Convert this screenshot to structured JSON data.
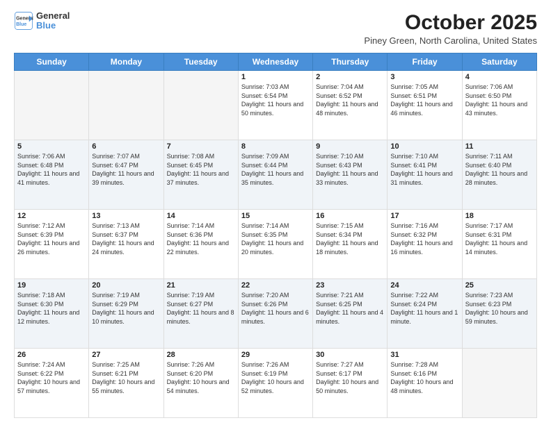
{
  "logo": {
    "line1": "General",
    "line2": "Blue"
  },
  "title": {
    "month_year": "October 2025",
    "location": "Piney Green, North Carolina, United States"
  },
  "days_of_week": [
    "Sunday",
    "Monday",
    "Tuesday",
    "Wednesday",
    "Thursday",
    "Friday",
    "Saturday"
  ],
  "weeks": [
    [
      {
        "day": "",
        "sunrise": "",
        "sunset": "",
        "daylight": ""
      },
      {
        "day": "",
        "sunrise": "",
        "sunset": "",
        "daylight": ""
      },
      {
        "day": "",
        "sunrise": "",
        "sunset": "",
        "daylight": ""
      },
      {
        "day": "1",
        "sunrise": "Sunrise: 7:03 AM",
        "sunset": "Sunset: 6:54 PM",
        "daylight": "Daylight: 11 hours and 50 minutes."
      },
      {
        "day": "2",
        "sunrise": "Sunrise: 7:04 AM",
        "sunset": "Sunset: 6:52 PM",
        "daylight": "Daylight: 11 hours and 48 minutes."
      },
      {
        "day": "3",
        "sunrise": "Sunrise: 7:05 AM",
        "sunset": "Sunset: 6:51 PM",
        "daylight": "Daylight: 11 hours and 46 minutes."
      },
      {
        "day": "4",
        "sunrise": "Sunrise: 7:06 AM",
        "sunset": "Sunset: 6:50 PM",
        "daylight": "Daylight: 11 hours and 43 minutes."
      }
    ],
    [
      {
        "day": "5",
        "sunrise": "Sunrise: 7:06 AM",
        "sunset": "Sunset: 6:48 PM",
        "daylight": "Daylight: 11 hours and 41 minutes."
      },
      {
        "day": "6",
        "sunrise": "Sunrise: 7:07 AM",
        "sunset": "Sunset: 6:47 PM",
        "daylight": "Daylight: 11 hours and 39 minutes."
      },
      {
        "day": "7",
        "sunrise": "Sunrise: 7:08 AM",
        "sunset": "Sunset: 6:45 PM",
        "daylight": "Daylight: 11 hours and 37 minutes."
      },
      {
        "day": "8",
        "sunrise": "Sunrise: 7:09 AM",
        "sunset": "Sunset: 6:44 PM",
        "daylight": "Daylight: 11 hours and 35 minutes."
      },
      {
        "day": "9",
        "sunrise": "Sunrise: 7:10 AM",
        "sunset": "Sunset: 6:43 PM",
        "daylight": "Daylight: 11 hours and 33 minutes."
      },
      {
        "day": "10",
        "sunrise": "Sunrise: 7:10 AM",
        "sunset": "Sunset: 6:41 PM",
        "daylight": "Daylight: 11 hours and 31 minutes."
      },
      {
        "day": "11",
        "sunrise": "Sunrise: 7:11 AM",
        "sunset": "Sunset: 6:40 PM",
        "daylight": "Daylight: 11 hours and 28 minutes."
      }
    ],
    [
      {
        "day": "12",
        "sunrise": "Sunrise: 7:12 AM",
        "sunset": "Sunset: 6:39 PM",
        "daylight": "Daylight: 11 hours and 26 minutes."
      },
      {
        "day": "13",
        "sunrise": "Sunrise: 7:13 AM",
        "sunset": "Sunset: 6:37 PM",
        "daylight": "Daylight: 11 hours and 24 minutes."
      },
      {
        "day": "14",
        "sunrise": "Sunrise: 7:14 AM",
        "sunset": "Sunset: 6:36 PM",
        "daylight": "Daylight: 11 hours and 22 minutes."
      },
      {
        "day": "15",
        "sunrise": "Sunrise: 7:14 AM",
        "sunset": "Sunset: 6:35 PM",
        "daylight": "Daylight: 11 hours and 20 minutes."
      },
      {
        "day": "16",
        "sunrise": "Sunrise: 7:15 AM",
        "sunset": "Sunset: 6:34 PM",
        "daylight": "Daylight: 11 hours and 18 minutes."
      },
      {
        "day": "17",
        "sunrise": "Sunrise: 7:16 AM",
        "sunset": "Sunset: 6:32 PM",
        "daylight": "Daylight: 11 hours and 16 minutes."
      },
      {
        "day": "18",
        "sunrise": "Sunrise: 7:17 AM",
        "sunset": "Sunset: 6:31 PM",
        "daylight": "Daylight: 11 hours and 14 minutes."
      }
    ],
    [
      {
        "day": "19",
        "sunrise": "Sunrise: 7:18 AM",
        "sunset": "Sunset: 6:30 PM",
        "daylight": "Daylight: 11 hours and 12 minutes."
      },
      {
        "day": "20",
        "sunrise": "Sunrise: 7:19 AM",
        "sunset": "Sunset: 6:29 PM",
        "daylight": "Daylight: 11 hours and 10 minutes."
      },
      {
        "day": "21",
        "sunrise": "Sunrise: 7:19 AM",
        "sunset": "Sunset: 6:27 PM",
        "daylight": "Daylight: 11 hours and 8 minutes."
      },
      {
        "day": "22",
        "sunrise": "Sunrise: 7:20 AM",
        "sunset": "Sunset: 6:26 PM",
        "daylight": "Daylight: 11 hours and 6 minutes."
      },
      {
        "day": "23",
        "sunrise": "Sunrise: 7:21 AM",
        "sunset": "Sunset: 6:25 PM",
        "daylight": "Daylight: 11 hours and 4 minutes."
      },
      {
        "day": "24",
        "sunrise": "Sunrise: 7:22 AM",
        "sunset": "Sunset: 6:24 PM",
        "daylight": "Daylight: 11 hours and 1 minute."
      },
      {
        "day": "25",
        "sunrise": "Sunrise: 7:23 AM",
        "sunset": "Sunset: 6:23 PM",
        "daylight": "Daylight: 10 hours and 59 minutes."
      }
    ],
    [
      {
        "day": "26",
        "sunrise": "Sunrise: 7:24 AM",
        "sunset": "Sunset: 6:22 PM",
        "daylight": "Daylight: 10 hours and 57 minutes."
      },
      {
        "day": "27",
        "sunrise": "Sunrise: 7:25 AM",
        "sunset": "Sunset: 6:21 PM",
        "daylight": "Daylight: 10 hours and 55 minutes."
      },
      {
        "day": "28",
        "sunrise": "Sunrise: 7:26 AM",
        "sunset": "Sunset: 6:20 PM",
        "daylight": "Daylight: 10 hours and 54 minutes."
      },
      {
        "day": "29",
        "sunrise": "Sunrise: 7:26 AM",
        "sunset": "Sunset: 6:19 PM",
        "daylight": "Daylight: 10 hours and 52 minutes."
      },
      {
        "day": "30",
        "sunrise": "Sunrise: 7:27 AM",
        "sunset": "Sunset: 6:17 PM",
        "daylight": "Daylight: 10 hours and 50 minutes."
      },
      {
        "day": "31",
        "sunrise": "Sunrise: 7:28 AM",
        "sunset": "Sunset: 6:16 PM",
        "daylight": "Daylight: 10 hours and 48 minutes."
      },
      {
        "day": "",
        "sunrise": "",
        "sunset": "",
        "daylight": ""
      }
    ]
  ]
}
